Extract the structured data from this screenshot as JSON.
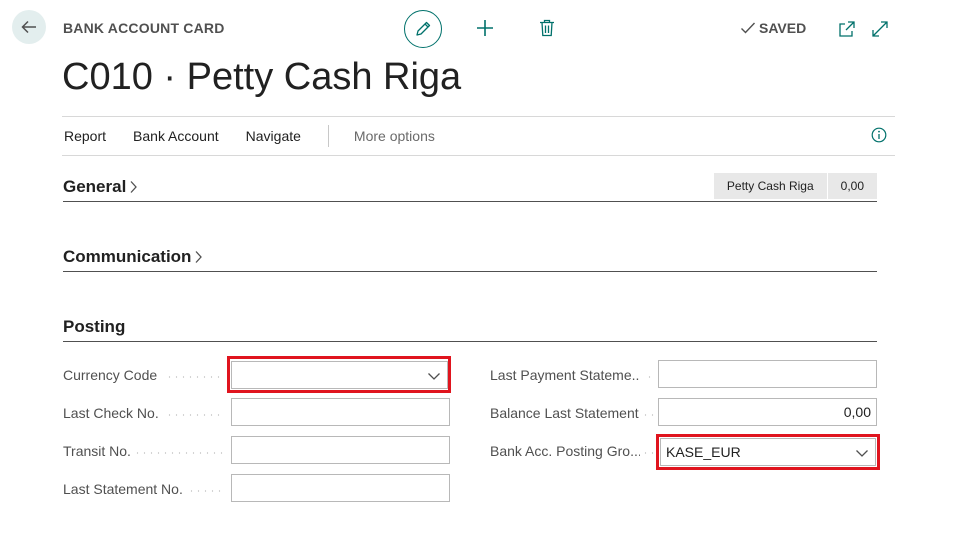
{
  "header": {
    "page_kind": "BANK ACCOUNT CARD",
    "title": "C010 · Petty Cash Riga",
    "saved_label": "SAVED"
  },
  "actions": {
    "items": [
      "Report",
      "Bank Account",
      "Navigate"
    ],
    "more": "More options"
  },
  "sections": {
    "general": {
      "title": "General",
      "summary": [
        "Petty Cash Riga",
        "0,00"
      ]
    },
    "communication": {
      "title": "Communication"
    },
    "posting": {
      "title": "Posting"
    }
  },
  "posting_fields": {
    "currency_code": {
      "label": "Currency Code",
      "value": ""
    },
    "last_check_no": {
      "label": "Last Check No.",
      "value": ""
    },
    "transit_no": {
      "label": "Transit No.",
      "value": ""
    },
    "last_statement_no": {
      "label": "Last Statement No.",
      "value": ""
    },
    "last_payment_statement": {
      "label": "Last Payment Stateme...",
      "value": ""
    },
    "balance_last_statement": {
      "label": "Balance Last Statement",
      "value": "0,00"
    },
    "bank_acc_posting_group": {
      "label": "Bank Acc. Posting Gro...",
      "value": "KASE_EUR"
    }
  },
  "colors": {
    "accent": "#00716b",
    "highlight": "#e0141e"
  }
}
